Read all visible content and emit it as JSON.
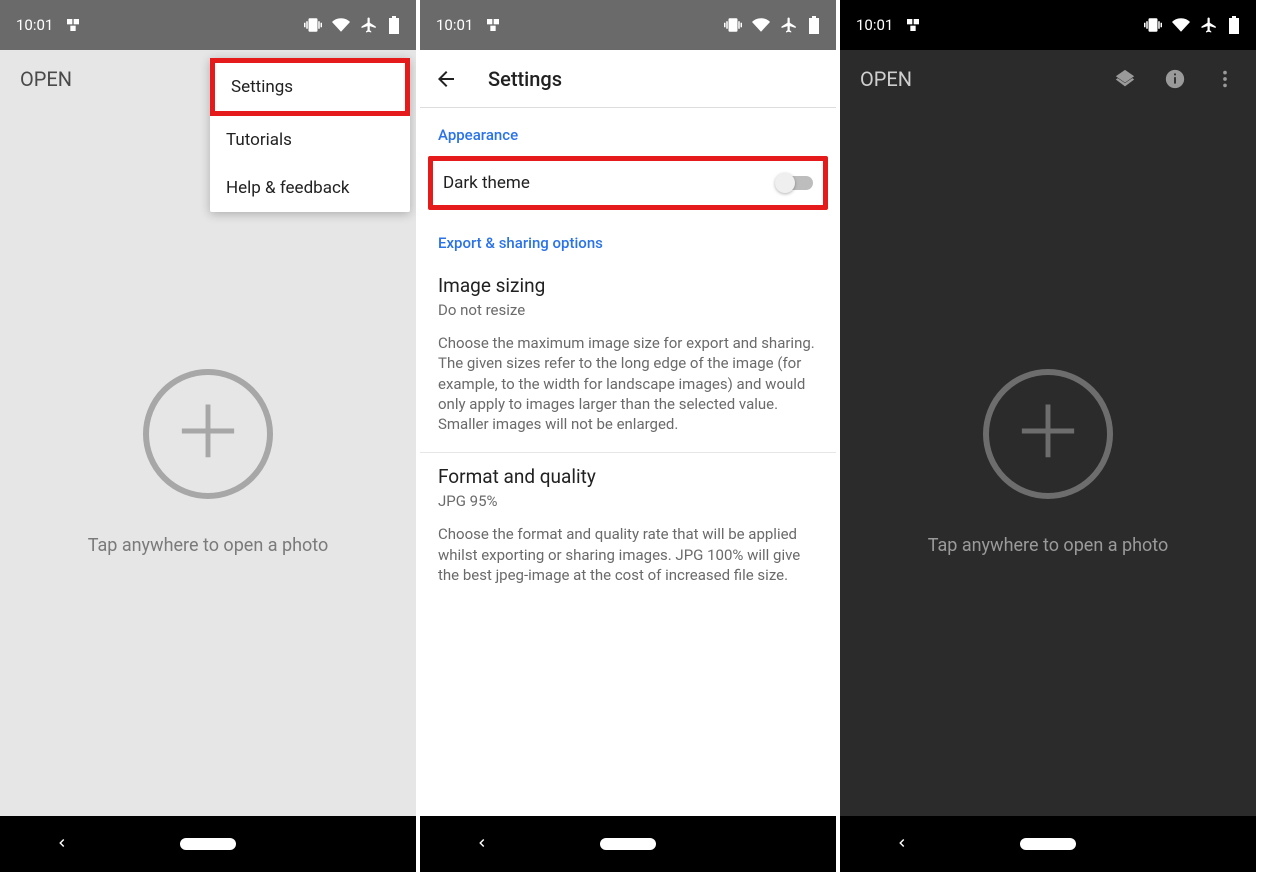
{
  "status": {
    "time": "10:01"
  },
  "screen1": {
    "openLabel": "OPEN",
    "tapText": "Tap anywhere to open a photo",
    "menu": {
      "settings": "Settings",
      "tutorials": "Tutorials",
      "help": "Help & feedback"
    }
  },
  "screen2": {
    "title": "Settings",
    "appearanceHeader": "Appearance",
    "darkThemeLabel": "Dark theme",
    "exportHeader": "Export & sharing options",
    "imageSizing": {
      "title": "Image sizing",
      "sub": "Do not resize",
      "desc": "Choose the maximum image size for export and sharing. The given sizes refer to the long edge of the image (for example, to the width for landscape images) and would only apply to images larger than the selected value. Smaller images will not be enlarged."
    },
    "formatQuality": {
      "title": "Format and quality",
      "sub": "JPG 95%",
      "desc": "Choose the format and quality rate that will be applied whilst exporting or sharing images. JPG 100% will give the best jpeg-image at the cost of increased file size."
    }
  },
  "screen3": {
    "openLabel": "OPEN",
    "tapText": "Tap anywhere to open a photo"
  }
}
